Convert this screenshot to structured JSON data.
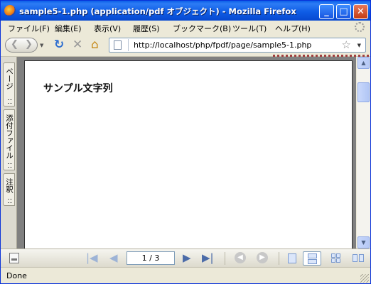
{
  "window": {
    "title": "sample5-1.php (application/pdf オブジェクト) - Mozilla Firefox",
    "minimize_glyph": "_",
    "maximize_glyph": "□",
    "close_glyph": "✕"
  },
  "menu": {
    "items": [
      {
        "label": "ファイル(F)"
      },
      {
        "label": "編集(E)"
      },
      {
        "label": "表示(V)"
      },
      {
        "label": "履歴(S)"
      },
      {
        "label": "ブックマーク(B)"
      },
      {
        "label": "ツール(T)"
      },
      {
        "label": "ヘルプ(H)"
      }
    ]
  },
  "nav": {
    "back_glyph": "❮",
    "forward_glyph": "❯",
    "reload_glyph": "↻",
    "stop_glyph": "✕",
    "home_glyph": "⌂",
    "url": "http://localhost/php/fpdf/page/sample5-1.php",
    "star_glyph": "☆"
  },
  "pdf_sidebar": {
    "tabs": [
      {
        "label": "ページ"
      },
      {
        "label": "添付ファイル"
      },
      {
        "label": "注釈"
      }
    ]
  },
  "pdf_page": {
    "text": "サンプル文字列"
  },
  "pdf_toolbar": {
    "page_display": "1 / 3",
    "first_glyph": "|◀",
    "prev_glyph": "◀",
    "next_glyph": "▶",
    "last_glyph": "▶|",
    "back_view_glyph": "◀",
    "forward_view_glyph": "▶"
  },
  "status": {
    "text": "Done"
  },
  "colors": {
    "titlebar": "#0a5fe8",
    "pdf_background": "#808080",
    "toolbar_icon": "#4b6ba8"
  },
  "icons": [
    "firefox-icon",
    "back-icon",
    "forward-icon",
    "reload-icon",
    "stop-icon",
    "home-icon",
    "page-icon",
    "bookmark-star-icon",
    "throbber-icon",
    "sidebar-toggle-icon",
    "first-page-icon",
    "previous-page-icon",
    "next-page-icon",
    "last-page-icon",
    "previous-view-icon",
    "next-view-icon",
    "single-page-icon",
    "continuous-page-icon",
    "two-up-icon",
    "two-up-continuous-icon"
  ]
}
